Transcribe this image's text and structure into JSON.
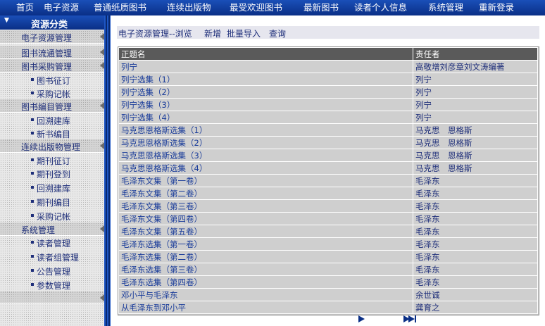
{
  "nav": {
    "items": [
      "首页",
      "电子资源",
      "普通纸质图书",
      "连续出版物",
      "最受欢迎图书",
      "最新图书",
      "读者个人信息",
      "系统管理",
      "重新登录"
    ]
  },
  "sidebar": {
    "title": "资源分类",
    "categories": [
      {
        "label": "电子资源管理",
        "subitems": []
      },
      {
        "label": "图书流通管理",
        "subitems": []
      },
      {
        "label": "图书采购管理",
        "subitems": [
          "图书征订",
          "采购记帐"
        ]
      },
      {
        "label": "图书编目管理",
        "subitems": [
          "回溯建库",
          "新书编目"
        ]
      },
      {
        "label": "连续出版物管理",
        "subitems": [
          "期刊征订",
          "期刊登到",
          "回溯建库",
          "期刊编目",
          "采购记帐"
        ]
      },
      {
        "label": "系统管理",
        "subitems": [
          "读者管理",
          "读者组管理",
          "公告管理",
          "参数管理"
        ]
      }
    ]
  },
  "toolbar": {
    "breadcrumb": "电子资源管理--浏览",
    "add": "新增",
    "import": "批量导入",
    "query": "查询"
  },
  "table": {
    "headers": [
      "正题名",
      "责任者"
    ],
    "rows": [
      [
        "列宁",
        "高敬增刘彦章刘文涛编著"
      ],
      [
        "列宁选集（1）",
        "列宁"
      ],
      [
        "列宁选集（2）",
        "列宁"
      ],
      [
        "列宁选集（3）",
        "列宁"
      ],
      [
        "列宁选集（4）",
        "列宁"
      ],
      [
        "马克思恩格斯选集（1）",
        "马克思　恩格斯"
      ],
      [
        "马克思恩格斯选集（2）",
        "马克思　恩格斯"
      ],
      [
        "马克思恩格斯选集（3）",
        "马克思　恩格斯"
      ],
      [
        "马克思恩格斯选集（4）",
        "马克思　恩格斯"
      ],
      [
        "毛泽东文集（第一卷）",
        "毛泽东"
      ],
      [
        "毛泽东文集（第二卷）",
        "毛泽东"
      ],
      [
        "毛泽东文集（第三卷）",
        "毛泽东"
      ],
      [
        "毛泽东文集（第四卷）",
        "毛泽东"
      ],
      [
        "毛泽东文集（第五卷）",
        "毛泽东"
      ],
      [
        "毛泽东选集（第一卷）",
        "毛泽东"
      ],
      [
        "毛泽东选集（第二卷）",
        "毛泽东"
      ],
      [
        "毛泽东选集（第三卷）",
        "毛泽东"
      ],
      [
        "毛泽东选集（第四卷）",
        "毛泽东"
      ],
      [
        "邓小平与毛泽东",
        "余世诚"
      ],
      [
        "从毛泽东到邓小平",
        "龚育之"
      ]
    ]
  },
  "pager": {
    "next_icon": "next-page-icon",
    "last_icon": "last-page-icon"
  },
  "colors": {
    "nav_bg": "#0d3a9c",
    "header_bg": "#5a5a5a",
    "cell_bg": "#cfcfcf",
    "text": "#1f2f7a"
  }
}
